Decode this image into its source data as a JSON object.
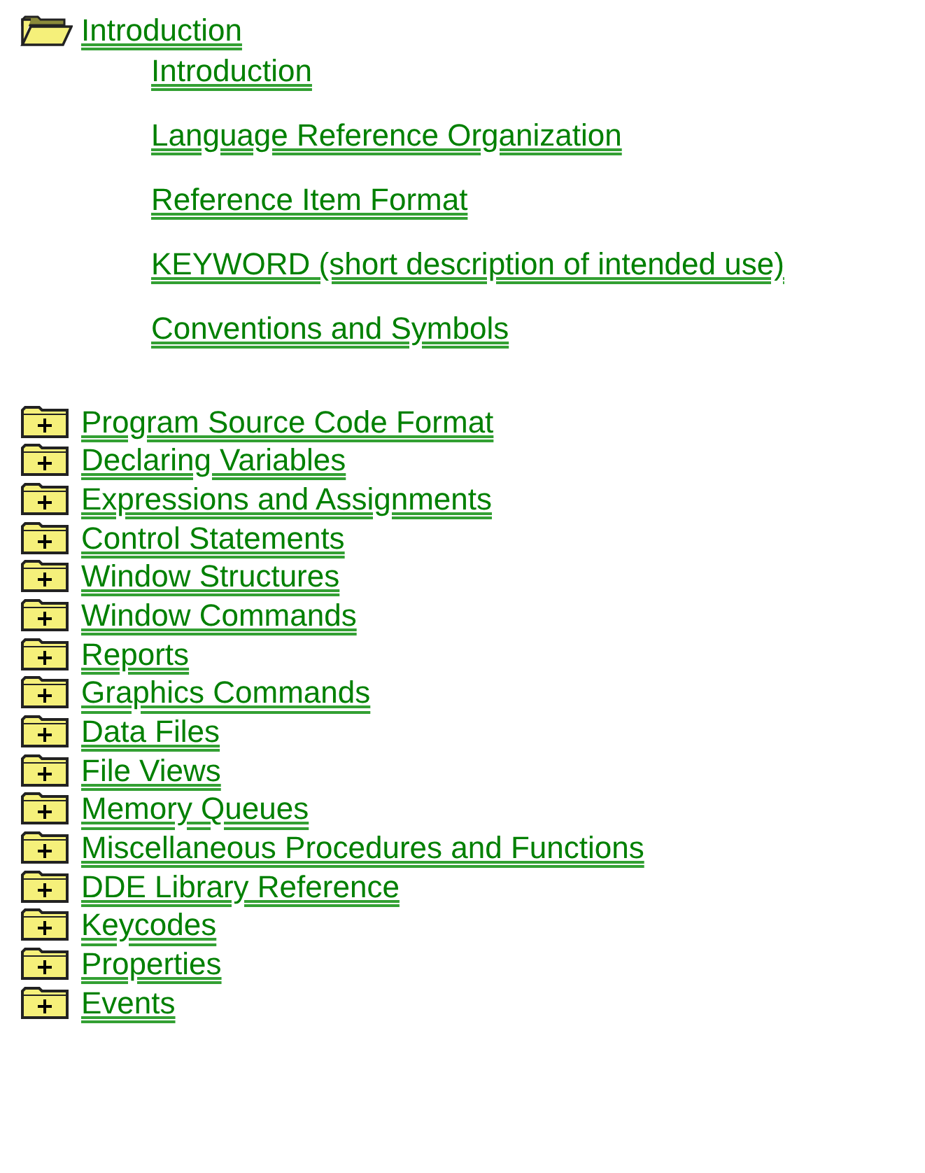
{
  "tree": [
    {
      "label": "Introduction",
      "expanded": true,
      "children": [
        {
          "label": "Introduction"
        },
        {
          "label": "Language Reference Organization"
        },
        {
          "label": "Reference Item Format"
        },
        {
          "label": "KEYWORD (short description of intended use)"
        },
        {
          "label": "Conventions and Symbols"
        }
      ]
    },
    {
      "label": "Program Source Code Format",
      "expanded": false
    },
    {
      "label": "Declaring Variables",
      "expanded": false
    },
    {
      "label": "Expressions and Assignments",
      "expanded": false
    },
    {
      "label": "Control Statements",
      "expanded": false
    },
    {
      "label": "Window Structures",
      "expanded": false
    },
    {
      "label": "Window Commands",
      "expanded": false
    },
    {
      "label": "Reports",
      "expanded": false
    },
    {
      "label": "Graphics Commands",
      "expanded": false
    },
    {
      "label": "Data Files",
      "expanded": false
    },
    {
      "label": "File Views",
      "expanded": false
    },
    {
      "label": "Memory Queues",
      "expanded": false
    },
    {
      "label": "Miscellaneous Procedures and Functions",
      "expanded": false
    },
    {
      "label": "DDE Library Reference",
      "expanded": false
    },
    {
      "label": "Keycodes",
      "expanded": false
    },
    {
      "label": "Properties",
      "expanded": false
    },
    {
      "label": "Events",
      "expanded": false
    }
  ]
}
